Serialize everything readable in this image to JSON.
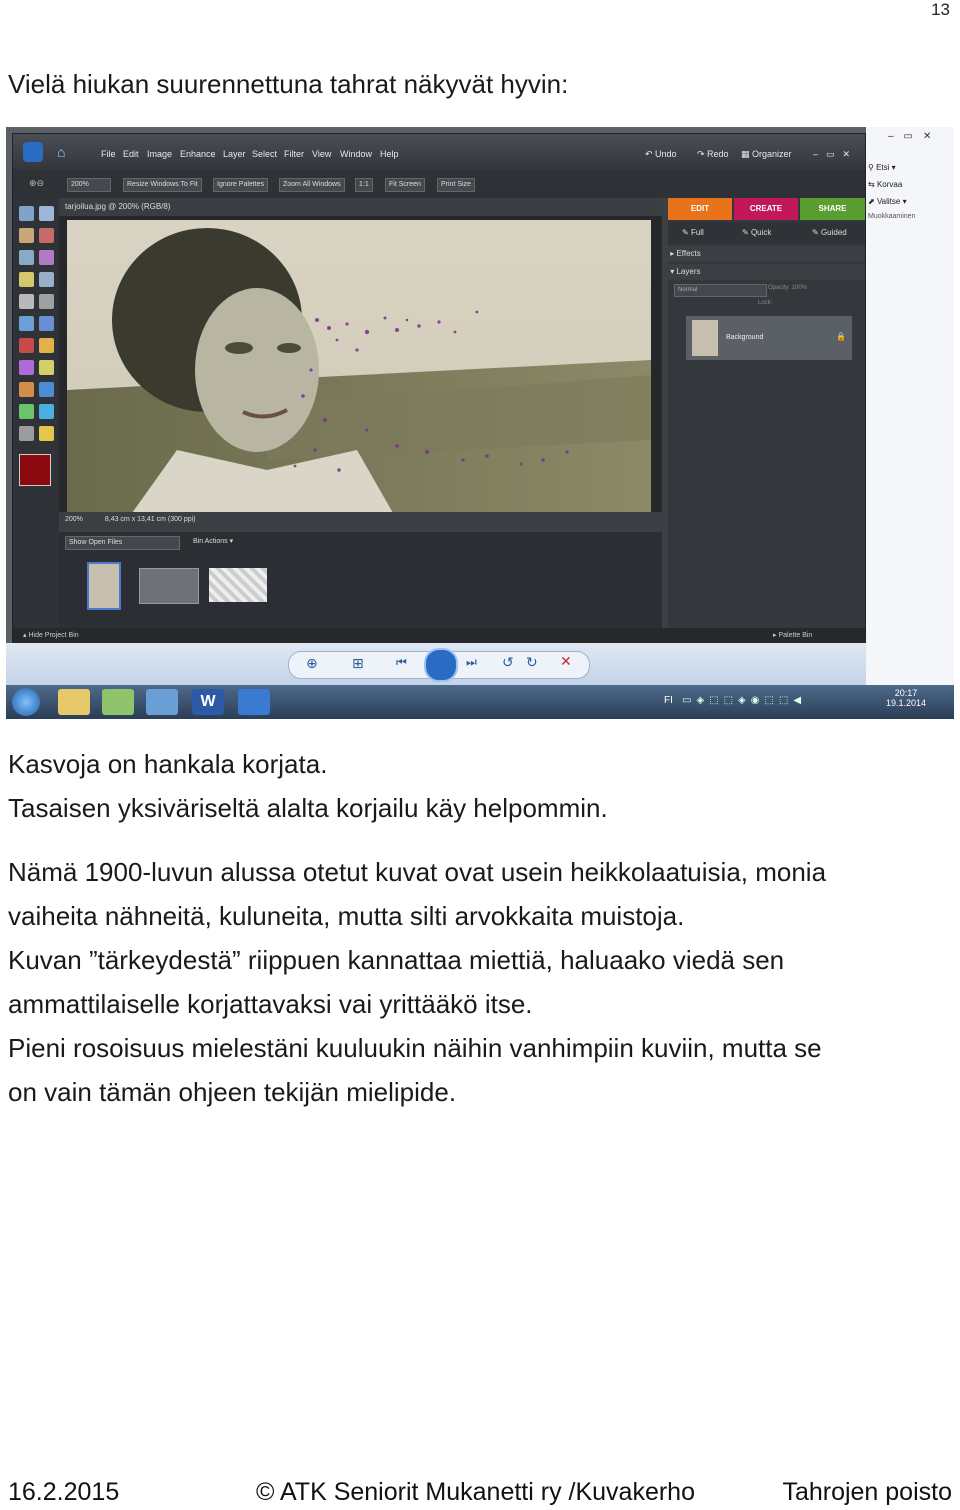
{
  "page_number": "13",
  "heading_line": "Vielä hiukan suurennettuna tahrat näkyvät hyvin:",
  "caption_lines": [
    "Kasvoja on hankala korjata.",
    "Tasaisen yksiväriseltä alalta korjailu käy helpommin."
  ],
  "body_lines": [
    "Nämä 1900-luvun alussa otetut kuvat ovat usein heikkolaatuisia, monia",
    "vaiheita nähneitä, kuluneita, mutta silti arvokkaita muistoja.",
    "Kuvan ”tärkeydestä” riippuen kannattaa miettiä, haluaako viedä sen",
    "ammattilaiselle korjattavaksi vai yrittääkö itse.",
    "Pieni rosoisuus mielestäni kuuluukin näihin vanhimpiin kuviin, mutta se",
    "on vain tämän ohjeen tekijän mielipide."
  ],
  "footer": {
    "date": "16.2.2015",
    "org": "© ATK Seniorit Mukanetti ry /Kuvakerho",
    "topic": "Tahrojen poisto"
  },
  "screenshot": {
    "menu": [
      "File",
      "Edit",
      "Image",
      "Enhance",
      "Layer",
      "Select",
      "Filter",
      "View",
      "Window",
      "Help"
    ],
    "undo": "Undo",
    "redo": "Redo",
    "organizer": "Organizer",
    "zoom": "200%",
    "options": [
      "Resize Windows To Fit",
      "Ignore Palettes",
      "Zoom All Windows",
      "1:1",
      "Fit Screen",
      "Print Size"
    ],
    "doc_title": "tarjoilua.jpg @ 200% (RGB/8)",
    "status_zoom": "200%",
    "status_size": "8,43 cm x 13,41 cm (300 ppi)",
    "bin_select": "Show Open Files",
    "bin_actions": "Bin Actions",
    "hide_bin": "Hide Project Bin",
    "palette_bin": "Palette Bin",
    "tabs": [
      "EDIT",
      "CREATE",
      "SHARE"
    ],
    "modes": [
      "Full",
      "Quick",
      "Guided"
    ],
    "panels": [
      "Effects",
      "Layers"
    ],
    "blend_mode": "Normal",
    "opacity_label": "Opacity:",
    "opacity_value": "100%",
    "lock_label": "Lock:",
    "layer_name": "Background",
    "ribbon": [
      "Etsi",
      "Korvaa",
      "Valitse",
      "Muokkaaminen"
    ],
    "clock_time": "20:17",
    "clock_date": "19.1.2014",
    "lang": "FI",
    "colors": {
      "edit_tab": "#e8731a",
      "create_tab": "#c2185b",
      "share_tab": "#5a9e2f",
      "fg_swatch": "#8b0a10"
    }
  }
}
